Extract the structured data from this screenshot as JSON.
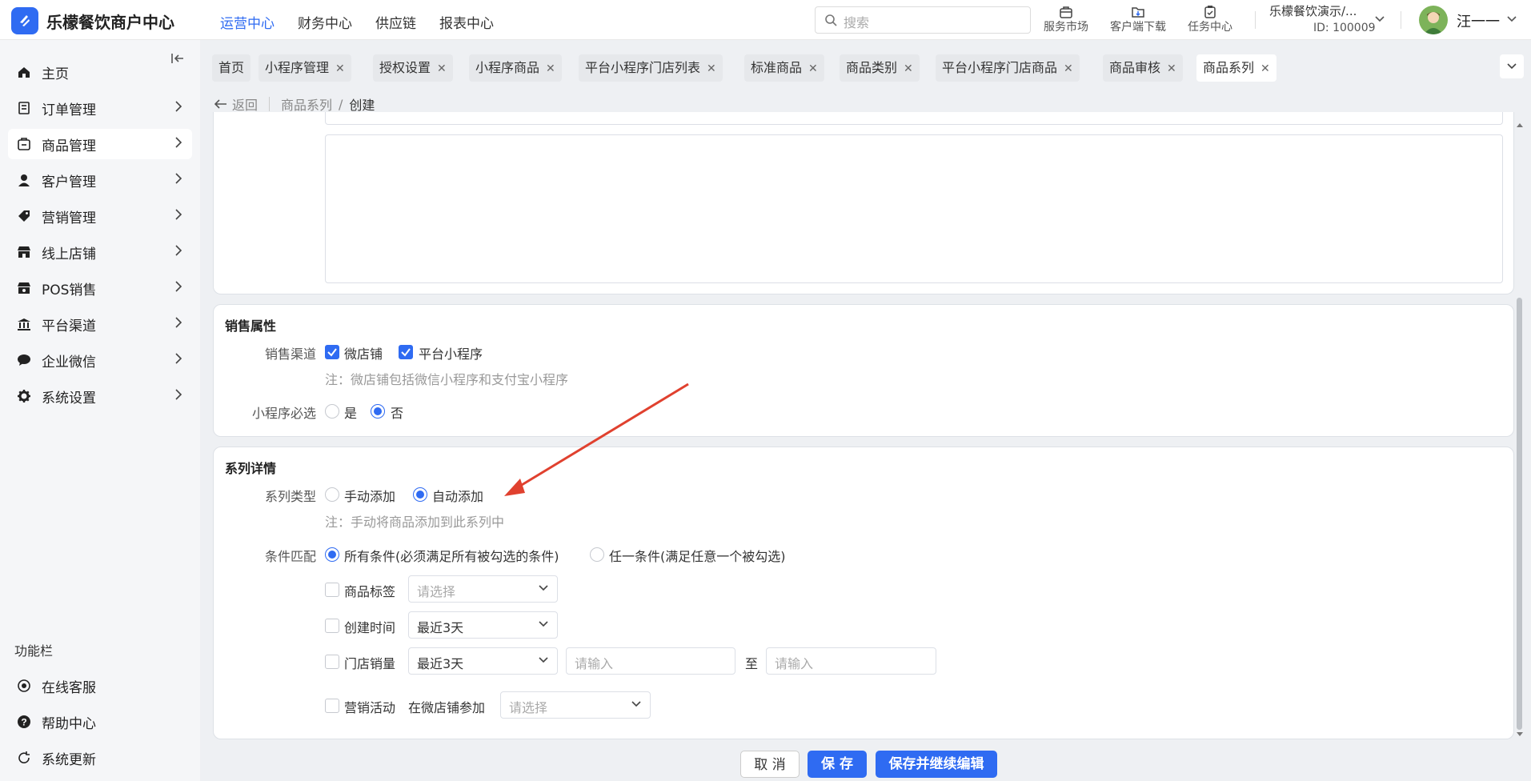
{
  "header": {
    "brand": "乐檬餐饮商户中心",
    "nav": [
      "运营中心",
      "财务中心",
      "供应链",
      "报表中心"
    ],
    "search_placeholder": "搜索",
    "tools": [
      {
        "label": "服务市场",
        "icon": "shop-bag-icon"
      },
      {
        "label": "客户端下载",
        "icon": "download-icon"
      },
      {
        "label": "任务中心",
        "icon": "task-icon"
      }
    ],
    "org_name": "乐檬餐饮演示/...",
    "org_id": "ID: 100009",
    "user": "汪一一"
  },
  "sidebar": {
    "items": [
      {
        "label": "主页",
        "icon": "home-icon"
      },
      {
        "label": "订单管理",
        "icon": "order-icon"
      },
      {
        "label": "商品管理",
        "icon": "goods-icon"
      },
      {
        "label": "客户管理",
        "icon": "customer-icon"
      },
      {
        "label": "营销管理",
        "icon": "tag-icon"
      },
      {
        "label": "线上店铺",
        "icon": "store-icon"
      },
      {
        "label": "POS销售",
        "icon": "pos-icon"
      },
      {
        "label": "平台渠道",
        "icon": "bank-icon"
      },
      {
        "label": "企业微信",
        "icon": "chat-icon"
      },
      {
        "label": "系统设置",
        "icon": "gear-icon"
      }
    ],
    "function_title": "功能栏",
    "functions": [
      {
        "label": "在线客服",
        "icon": "service-icon"
      },
      {
        "label": "帮助中心",
        "icon": "help-icon"
      },
      {
        "label": "系统更新",
        "icon": "refresh-icon"
      }
    ]
  },
  "tabs": [
    "首页",
    "小程序管理",
    "授权设置",
    "小程序商品",
    "平台小程序门店列表",
    "标准商品",
    "商品类别",
    "平台小程序门店商品",
    "商品审核",
    "商品系列"
  ],
  "breadcrumb": {
    "back": "返回",
    "parent": "商品系列",
    "sep": "/",
    "current": "创建"
  },
  "sales": {
    "title": "销售属性",
    "channel_label": "销售渠道",
    "channel_options": [
      "微店铺",
      "平台小程序"
    ],
    "channel_note": "注：微店铺包括微信小程序和支付宝小程序",
    "required_label": "小程序必选",
    "required_options": [
      "是",
      "否"
    ]
  },
  "series": {
    "title": "系列详情",
    "type_label": "系列类型",
    "type_options": [
      "手动添加",
      "自动添加"
    ],
    "type_note": "注：手动将商品添加到此系列中",
    "match_label": "条件匹配",
    "match_options": [
      "所有条件(必须满足所有被勾选的条件)",
      "任一条件(满足任意一个被勾选)"
    ],
    "cond_tag": "商品标签",
    "cond_tag_placeholder": "请选择",
    "cond_time": "创建时间",
    "cond_time_value": "最近3天",
    "cond_sales": "门店销量",
    "cond_sales_value": "最近3天",
    "input_placeholder": "请输入",
    "to": "至",
    "cond_promo": "营销活动",
    "promo_prefix": "在微店铺参加",
    "promo_placeholder": "请选择"
  },
  "footer": {
    "cancel": "取 消",
    "save": "保 存",
    "save_continue": "保存并继续编辑"
  },
  "colors": {
    "primary": "#2f6bf2",
    "arrow": "#e0412f"
  }
}
